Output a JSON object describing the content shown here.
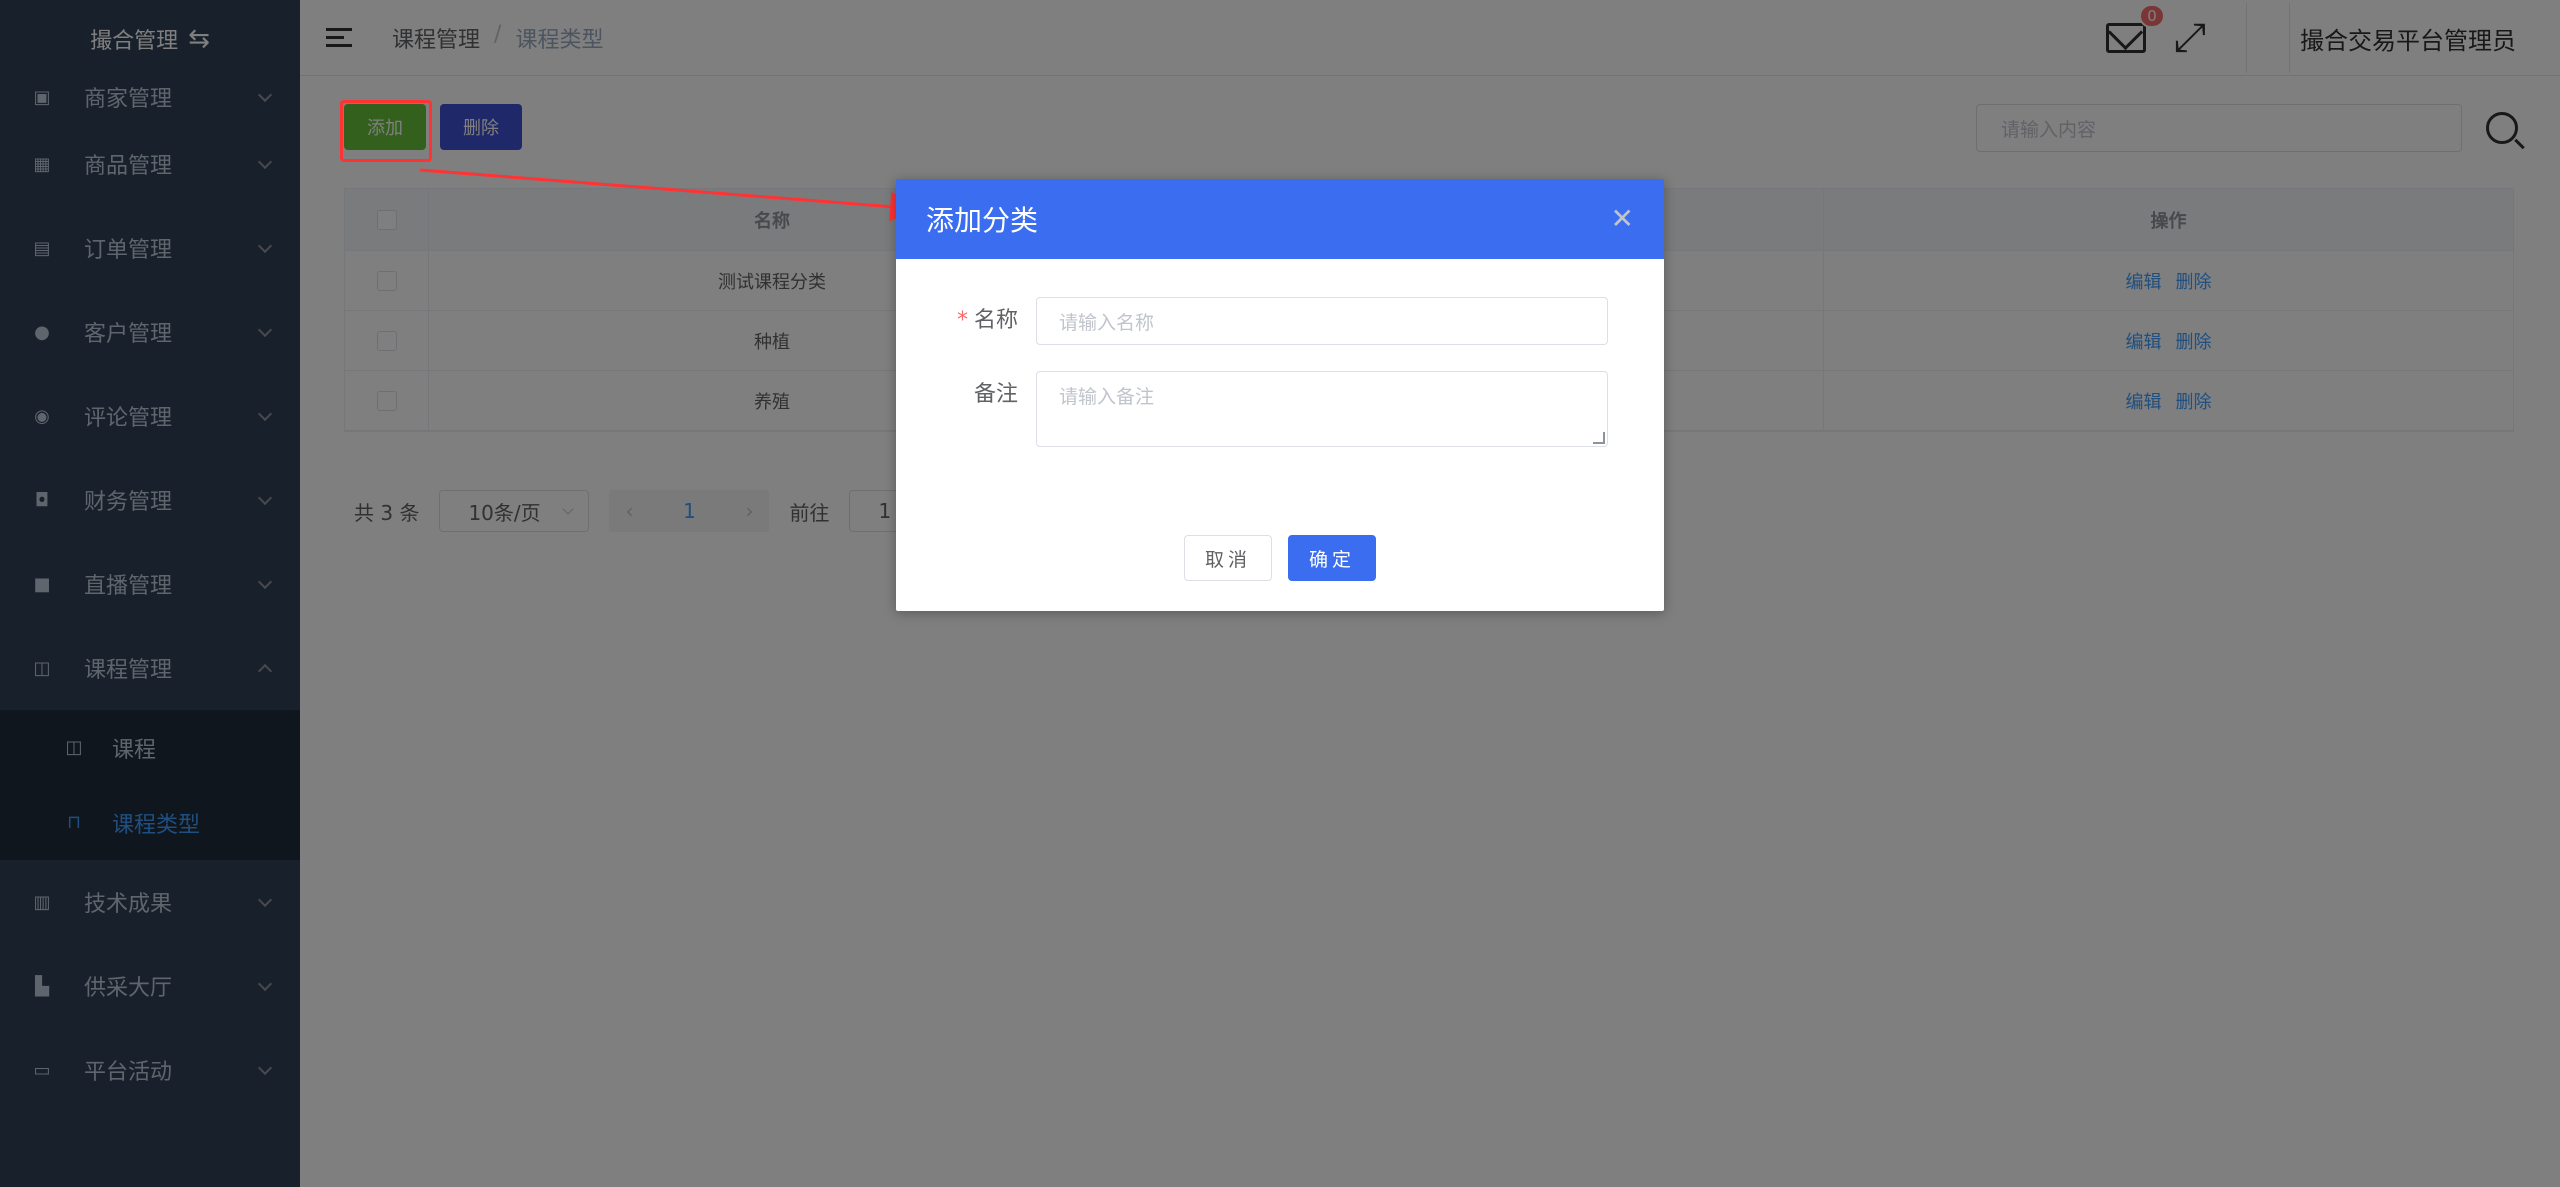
{
  "sidebar": {
    "brand": "撮合管理",
    "items": [
      {
        "label": "商家管理",
        "icon": "store-icon"
      },
      {
        "label": "商品管理",
        "icon": "gift-icon"
      },
      {
        "label": "订单管理",
        "icon": "document-icon"
      },
      {
        "label": "客户管理",
        "icon": "user-icon"
      },
      {
        "label": "评论管理",
        "icon": "shield-icon"
      },
      {
        "label": "财务管理",
        "icon": "wallet-icon"
      },
      {
        "label": "直播管理",
        "icon": "monitor-icon"
      },
      {
        "label": "课程管理",
        "icon": "book-icon"
      },
      {
        "label": "技术成果",
        "icon": "report-icon"
      },
      {
        "label": "供采大厅",
        "icon": "building-icon"
      },
      {
        "label": "平台活动",
        "icon": "screen-icon"
      }
    ],
    "submenu": [
      {
        "label": "课程"
      },
      {
        "label": "课程类型"
      }
    ]
  },
  "header": {
    "breadcrumb": [
      "课程管理",
      "课程类型"
    ],
    "badge": "0",
    "username": "撮合交易平台管理员"
  },
  "toolbar": {
    "add_label": "添加",
    "delete_label": "删除",
    "search_placeholder": "请输入内容"
  },
  "table": {
    "headers": {
      "name": "名称",
      "op": "操作"
    },
    "rows": [
      {
        "name": "测试课程分类",
        "edit": "编辑",
        "delete": "删除"
      },
      {
        "name": "种植",
        "edit": "编辑",
        "delete": "删除"
      },
      {
        "name": "养殖",
        "edit": "编辑",
        "delete": "删除"
      }
    ]
  },
  "pagination": {
    "total": "共 3 条",
    "page_size": "10条/页",
    "current": "1",
    "goto_label": "前往",
    "goto_value": "1"
  },
  "dialog": {
    "title": "添加分类",
    "name_label": "名称",
    "name_placeholder": "请输入名称",
    "remark_label": "备注",
    "remark_placeholder": "请输入备注",
    "cancel_label": "取消",
    "ok_label": "确定"
  },
  "colors": {
    "sidebar_bg": "#304156",
    "primary": "#3a6df0",
    "add_green": "#67c23a",
    "annotation_red": "#ff3333"
  }
}
